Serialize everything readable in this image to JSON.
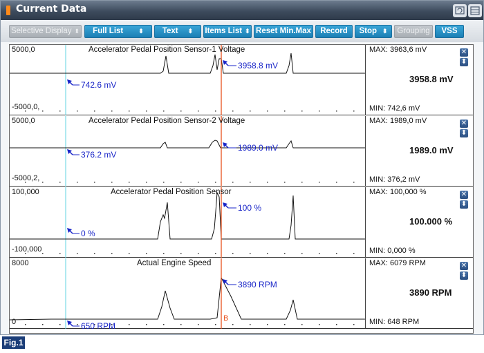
{
  "window": {
    "title": "Current Data",
    "colors": {
      "title_icon": "#ff8a1a",
      "button": "#1b7fb5",
      "cursor": "#e8501c",
      "marker": "#5fd3e0",
      "annotation": "#1a26c8"
    }
  },
  "toolbar": {
    "selective_display": "Selective Display",
    "full_list": "Full List",
    "text": "Text",
    "items_list": "Items List",
    "reset_min_max": "Reset Min.Max",
    "record": "Record",
    "stop": "Stop",
    "grouping": "Grouping",
    "vss": "VSS",
    "dropdown_glyph": "⬍"
  },
  "panels": [
    {
      "title": "Accelerator Pedal Position Sensor-1 Voltage",
      "ymax": "5000,0",
      "ymin": "-5000,0,",
      "max_text": "MAX: 3963,6 mV",
      "min_text": "MIN: 742,6 mV",
      "current": "3958.8 mV",
      "ann_cursor": "3958.8 mV",
      "ann_marker": "742.6 mV"
    },
    {
      "title": "Accelerator Pedal Position Sensor-2 Voltage",
      "ymax": "5000,0",
      "ymin": "-5000,2,",
      "max_text": "MAX: 1989,0 mV",
      "min_text": "MIN: 376,2 mV",
      "current": "1989.0 mV",
      "ann_cursor": "1989.0 mV",
      "ann_marker": "376.2 mV"
    },
    {
      "title": "Accelerator Pedal Position Sensor",
      "ymax": "100,000",
      "ymin": "-100,000",
      "max_text": "MAX: 100,000 %",
      "min_text": "MIN: 0,000 %",
      "current": "100.000 %",
      "ann_cursor": "100 %",
      "ann_marker": "0 %"
    },
    {
      "title": "Actual Engine Speed",
      "ymax": "8000",
      "ymin": "0",
      "max_text": "MAX:  6079 RPM",
      "min_text": "MIN:  648 RPM",
      "current": "3890 RPM",
      "ann_cursor": "3890 RPM",
      "ann_marker": "650 RPM",
      "cursor_label": "B"
    }
  ],
  "side_buttons": {
    "close": "✕",
    "swap": "⬍"
  },
  "figure_tag": "Fig.1"
}
